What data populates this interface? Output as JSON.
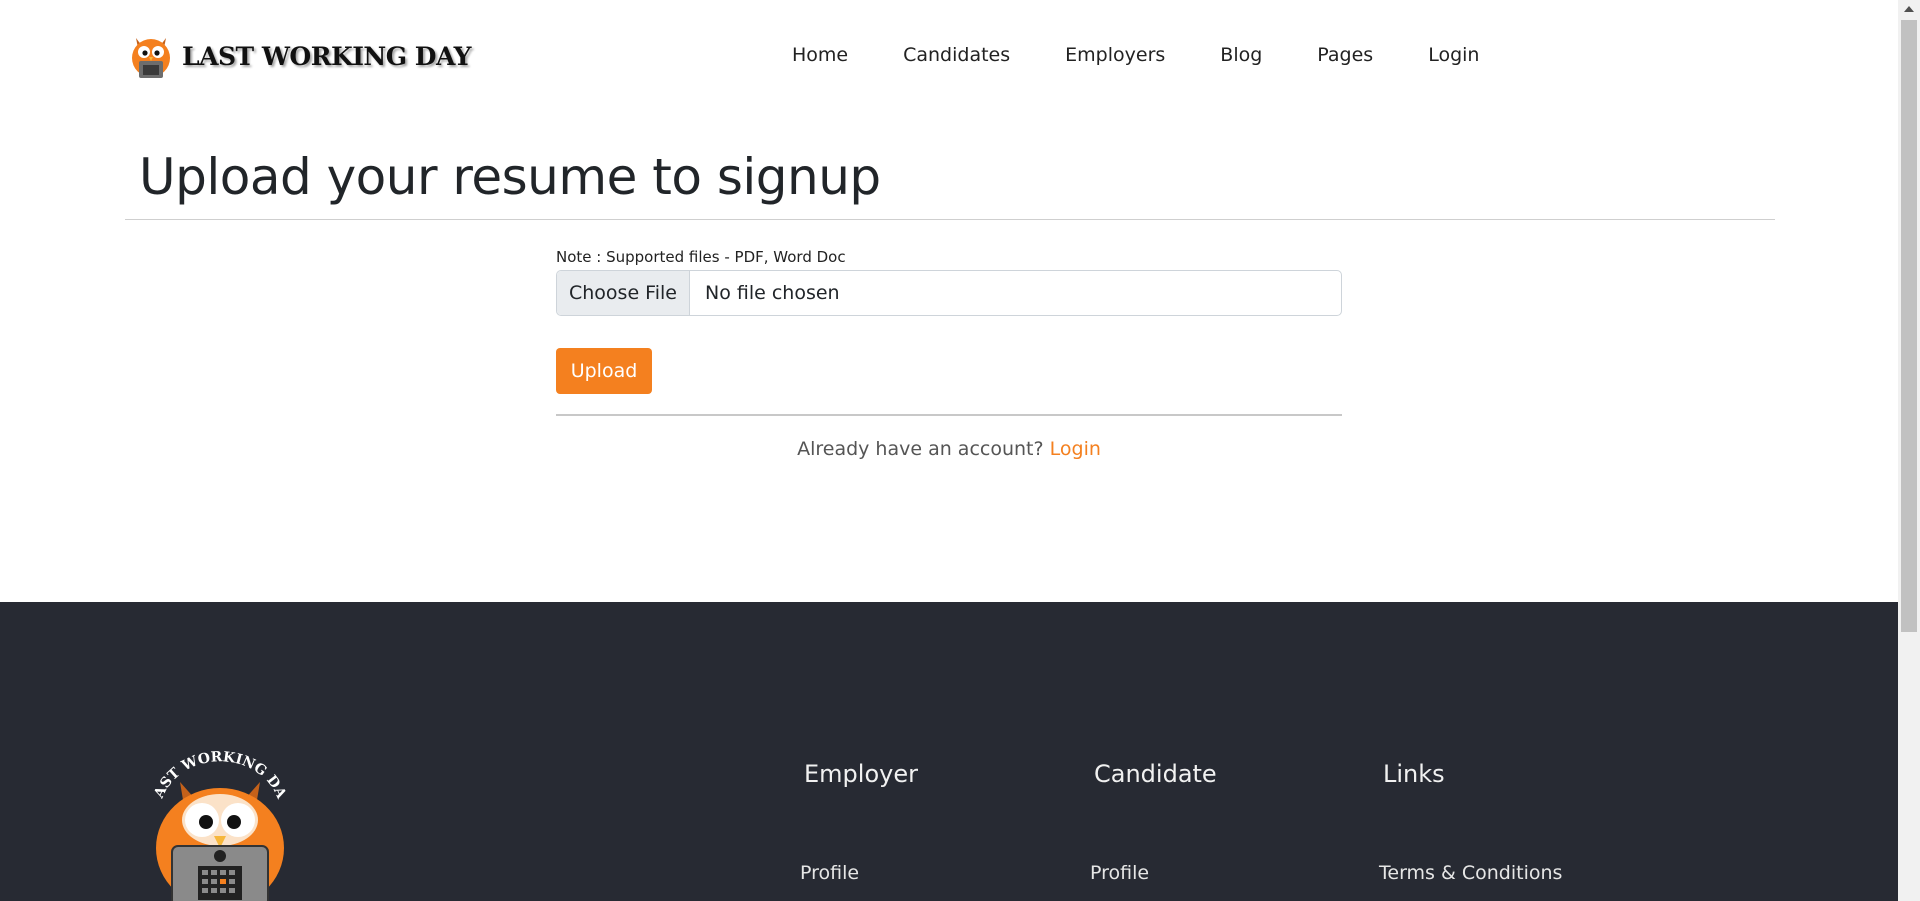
{
  "brand": {
    "name": "LAST WORKING DAY",
    "accent": "#f4801f"
  },
  "nav": [
    {
      "label": "Home"
    },
    {
      "label": "Candidates"
    },
    {
      "label": "Employers"
    },
    {
      "label": "Blog"
    },
    {
      "label": "Pages"
    },
    {
      "label": "Login"
    }
  ],
  "main": {
    "title": "Upload your resume to signup",
    "note": "Note : Supported files - PDF, Word Doc",
    "file_button": "Choose File",
    "file_status": "No file chosen",
    "upload_label": "Upload",
    "account_prompt": "Already have an account?",
    "login_link": "Login"
  },
  "footer": {
    "background": "#272a33",
    "logo_text": "LAST WORKING DAY",
    "columns": [
      {
        "heading": "Employer",
        "first_link": "Profile"
      },
      {
        "heading": "Candidate",
        "first_link": "Profile"
      },
      {
        "heading": "Links",
        "first_link": "Terms & Conditions"
      }
    ]
  }
}
